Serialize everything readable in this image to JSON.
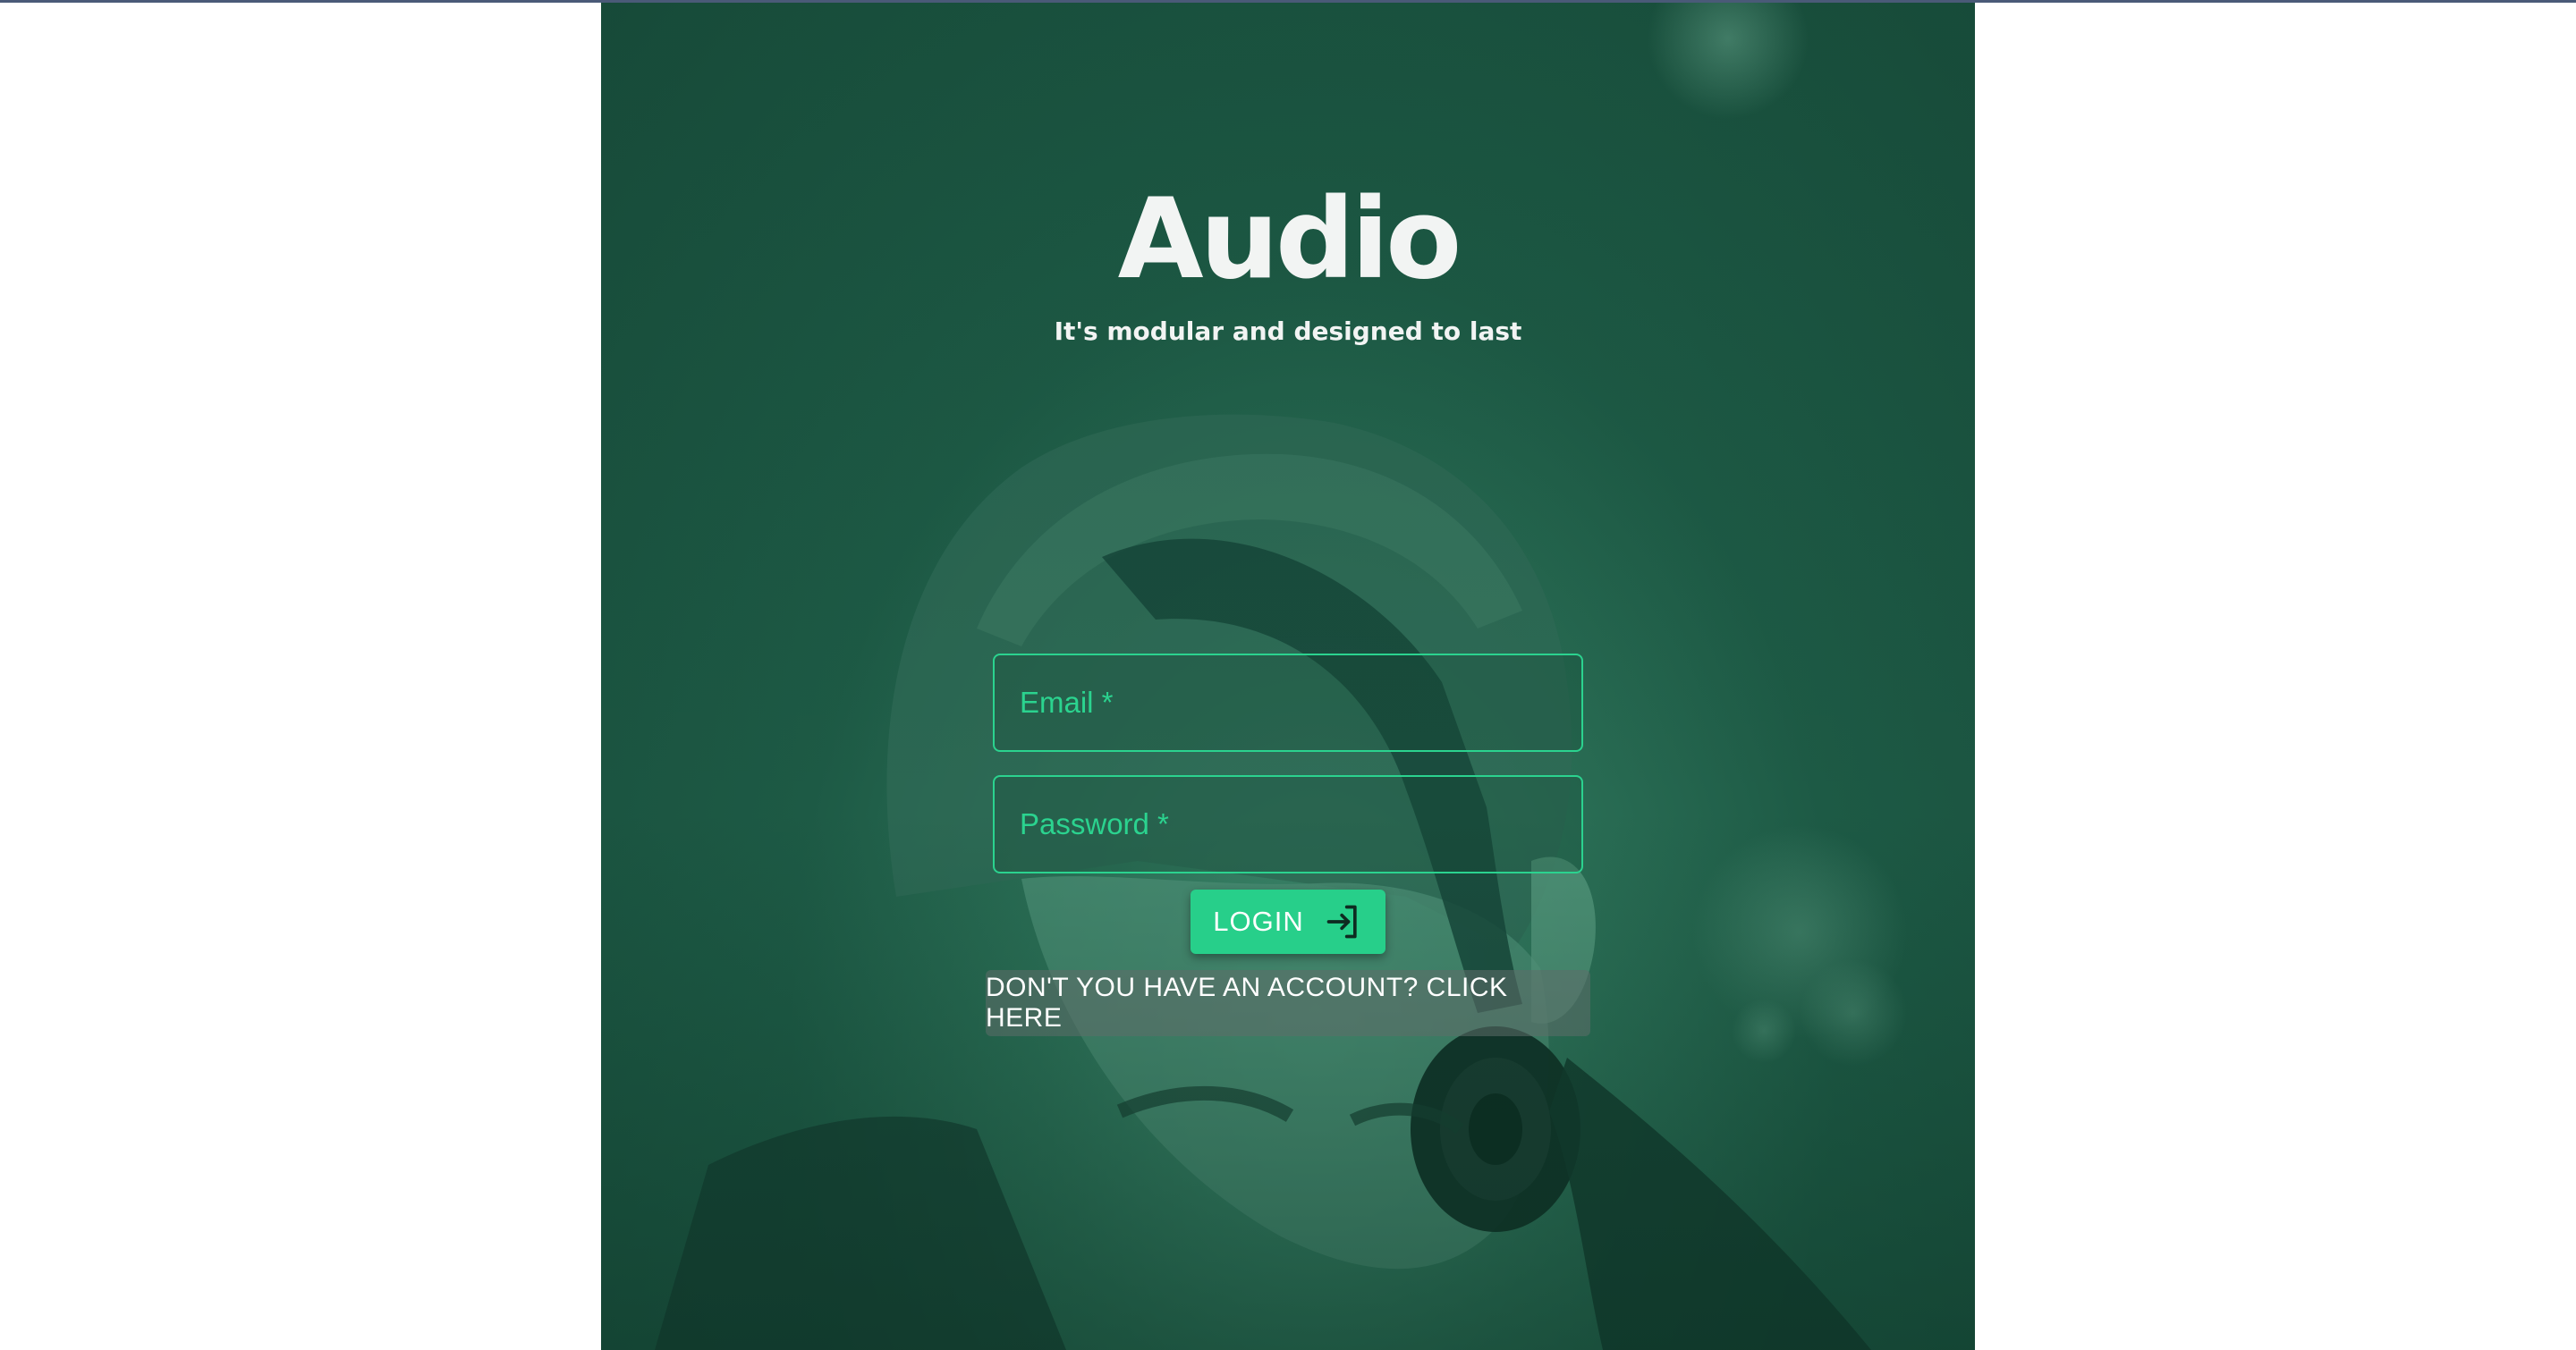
{
  "app": {
    "title": "Audio",
    "tagline": "It's modular and designed to last"
  },
  "form": {
    "email_placeholder": "Email *",
    "password_placeholder": "Password *",
    "login_label": "LOGIN",
    "login_icon": "login-arrow-icon",
    "signup_link_label": "DON'T YOU HAVE AN ACCOUNT? CLICK HERE"
  },
  "theme": {
    "panel_green": "#184d3b",
    "accent_green": "#2bd38f",
    "button_green": "#27cf8a",
    "text_light": "#f2f4f3"
  }
}
